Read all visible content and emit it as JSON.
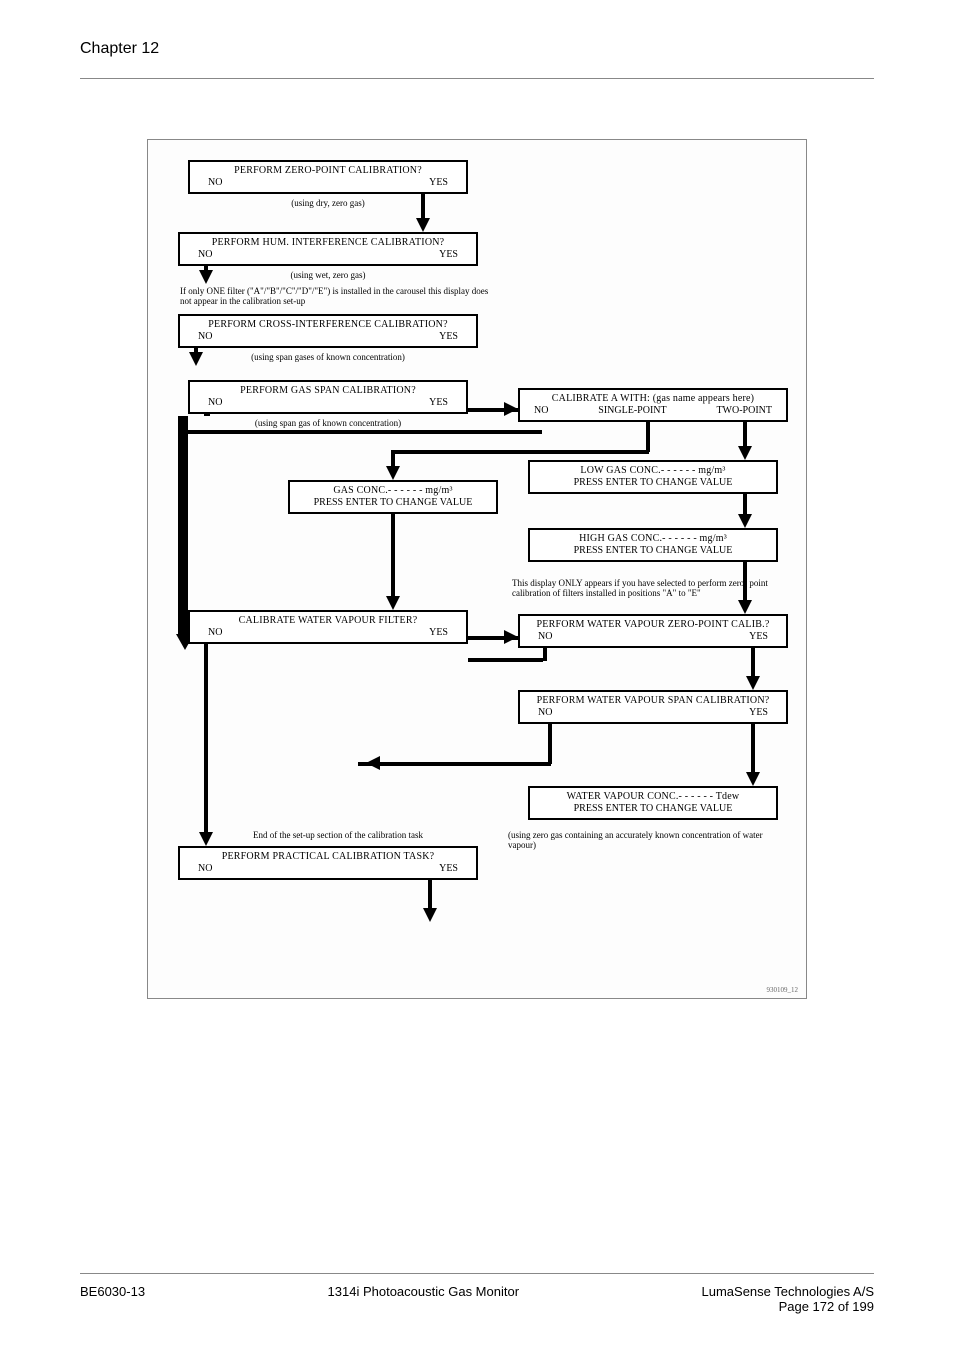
{
  "header": {
    "chapter": "Chapter 12"
  },
  "footer": {
    "doc_id": "BE6030-13",
    "product": "1314i Photoacoustic Gas Monitor",
    "company": "LumaSense Technologies A/S",
    "page": "Page 172 of 199"
  },
  "diagram": {
    "code": "930109_12",
    "boxes": {
      "zero_point": {
        "q": "PERFORM  ZERO-POINT  CALIBRATION?",
        "no": "NO",
        "yes": "YES"
      },
      "zero_point_note": "(using dry, zero gas)",
      "hum_interf": {
        "q": "PERFORM  HUM. INTERFERENCE  CALIBRATION?",
        "no": "NO",
        "yes": "YES"
      },
      "hum_interf_note": "(using wet, zero gas)",
      "one_filter_note": "If only ONE filter (\"A\"/\"B\"/\"C\"/\"D\"/\"E\") is installed in the carousel this display does not appear in the calibration set-up",
      "cross_interf": {
        "q": "PERFORM  CROSS-INTERFERENCE  CALIBRATION?",
        "no": "NO",
        "yes": "YES"
      },
      "cross_interf_note": "(using span gases of known concentration)",
      "gas_span": {
        "q": "PERFORM  GAS  SPAN  CALIBRATION?",
        "no": "NO",
        "yes": "YES"
      },
      "gas_span_note": "(using span gas of known concentration)",
      "cal_a": {
        "q": "CALIBRATE A WITH:  (gas name appears here)",
        "no": "NO",
        "single": "SINGLE-POINT",
        "two": "TWO-POINT"
      },
      "gas_conc": {
        "l1": "GAS CONC.- - - - - - mg/m³",
        "l2": "PRESS ENTER TO CHANGE VALUE"
      },
      "low_conc": {
        "l1": "LOW  GAS  CONC.- - - - - - mg/m³",
        "l2": "PRESS ENTER TO CHANGE VALUE"
      },
      "high_conc": {
        "l1": "HIGH  GAS  CONC.- - - - - - mg/m³",
        "l2": "PRESS ENTER TO CHANGE VALUE"
      },
      "wv_filter": {
        "q": "CALIBRATE  WATER VAPOUR  FILTER?",
        "no": "NO",
        "yes": "YES"
      },
      "display_only_note": "This display ONLY appears if you have selected to perform zero- point calibration of filters installed in positions \"A\" to \"E\"",
      "wv_zero": {
        "q": "PERFORM WATER VAPOUR ZERO-POINT CALIB.?",
        "no": "NO",
        "yes": "YES"
      },
      "wv_span": {
        "q": "PERFORM WATER VAPOUR SPAN CALIBRATION?",
        "no": "NO",
        "yes": "YES"
      },
      "wv_conc": {
        "l1": "WATER VAPOUR  CONC.- - - - - - Tdew",
        "l2": "PRESS ENTER TO CHANGE VALUE"
      },
      "wv_conc_note": "(using zero gas containing an accurately known concentration of water vapour)",
      "end_note": "End of the set-up section of the calibration task",
      "practical": {
        "q": "PERFORM  PRACTICAL  CALIBRATION  TASK?",
        "no": "NO",
        "yes": "YES"
      }
    }
  }
}
